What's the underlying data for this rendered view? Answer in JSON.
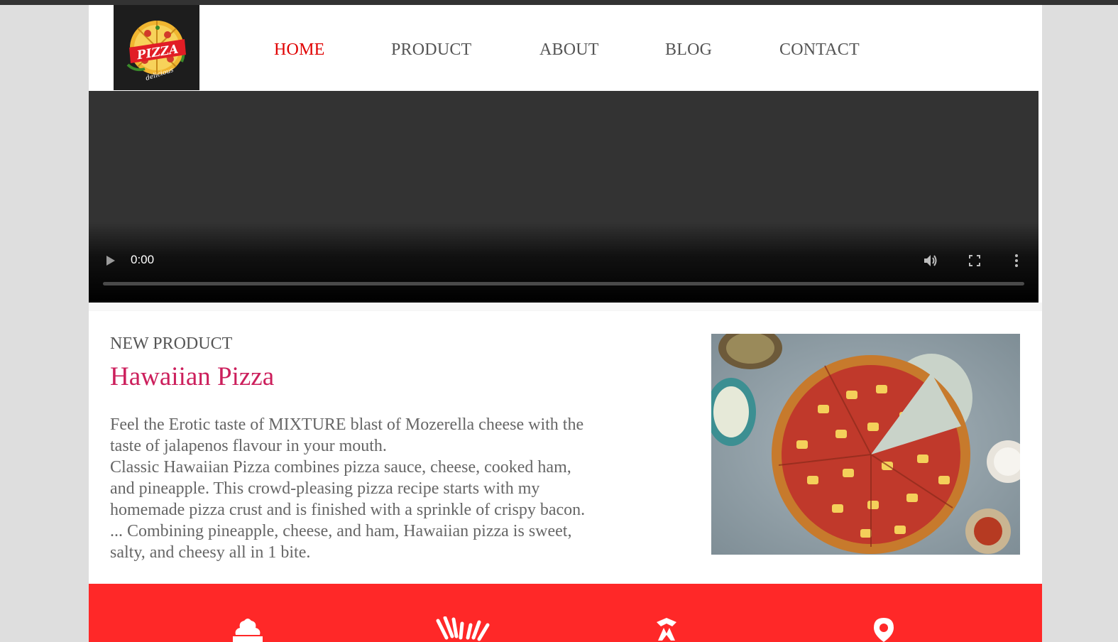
{
  "window": {
    "title": "Pizza delicious"
  },
  "brand": {
    "logo_word": "PIZZA",
    "logo_tagline": "delicious",
    "colors": {
      "nav_active": "#e00000",
      "title_pink": "#cc1f5c",
      "band_red": "#ff2828"
    }
  },
  "nav": {
    "items": [
      {
        "label": "HOME",
        "active": true
      },
      {
        "label": "PRODUCT",
        "active": false
      },
      {
        "label": "ABOUT",
        "active": false
      },
      {
        "label": "BLOG",
        "active": false
      },
      {
        "label": "CONTACT",
        "active": false
      }
    ]
  },
  "video": {
    "time": "0:00",
    "progress": 0,
    "controls": [
      "play-icon",
      "volume-icon",
      "fullscreen-icon",
      "more-vertical-icon"
    ]
  },
  "product": {
    "eyebrow": "NEW PRODUCT",
    "title": "Hawaiian Pizza",
    "description_lines": [
      "Feel the Erotic taste of MIXTURE blast of Mozerella cheese with the",
      "taste of jalapenos flavour in your mouth.",
      "Classic Hawaiian Pizza combines pizza sauce, cheese, cooked ham,",
      "and pineapple. This crowd-pleasing pizza recipe starts with my",
      "homemade pizza crust and is finished with a sprinkle of crispy bacon.",
      "... Combining pineapple, cheese, and ham, Hawaiian pizza is sweet,",
      "salty, and cheesy all in 1 bite."
    ],
    "image": "hawaiian-pizza-photo"
  },
  "features": {
    "icons": [
      "dessert-icon",
      "hands-icon",
      "chef-icon",
      "location-pin-icon"
    ]
  }
}
